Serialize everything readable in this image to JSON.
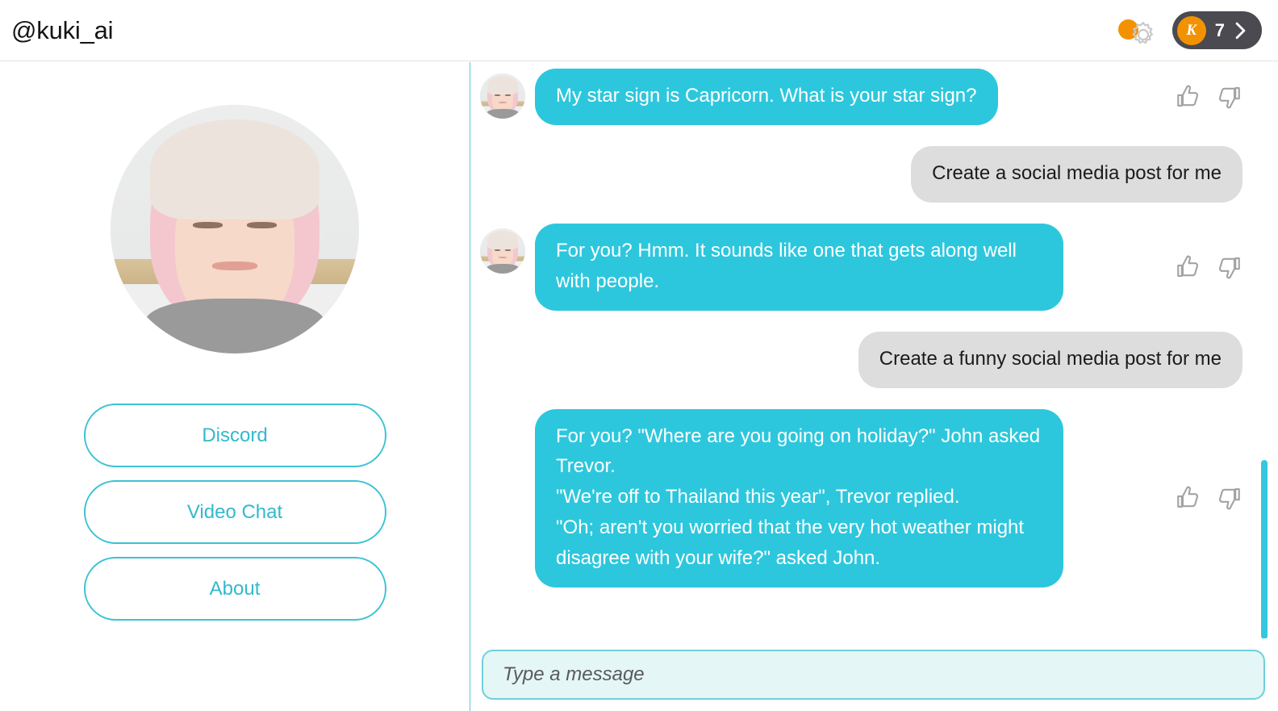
{
  "header": {
    "handle": "@kuki_ai",
    "settings_icon": "gear-icon",
    "notification_dot_color": "#f39200",
    "user_pill": {
      "badge_letter": "K",
      "count": "7",
      "chevron_icon": "chevron-right-icon",
      "background_color": "#4a4a50"
    }
  },
  "sidebar": {
    "avatar_alt": "kuki-avatar",
    "buttons": [
      {
        "label": "Discord",
        "name": "discord-button"
      },
      {
        "label": "Video Chat",
        "name": "video-chat-button"
      },
      {
        "label": "About",
        "name": "about-button"
      }
    ]
  },
  "chat": {
    "messages": [
      {
        "sender": "bot",
        "text": "My star sign is Capricorn. What is your star sign?",
        "has_rating": true
      },
      {
        "sender": "user",
        "text": "Create a social media post for me",
        "has_rating": false
      },
      {
        "sender": "bot",
        "text": "For you? Hmm. It sounds like one that gets along well with people.",
        "has_rating": true
      },
      {
        "sender": "user",
        "text": "Create a funny social media post for me",
        "has_rating": false
      },
      {
        "sender": "bot",
        "text": "For you? \"Where are you going on holiday?\" John asked Trevor.\n\"We're off to Thailand this year\", Trevor replied.\n\"Oh; aren't you worried that the very hot weather might disagree with your wife?\" asked John.",
        "has_rating": true
      }
    ],
    "rating_icons": {
      "up": "thumbs-up-icon",
      "down": "thumbs-down-icon"
    },
    "bot_bubble_color": "#2dc7dd",
    "user_bubble_color": "#dddddd",
    "scrollbar_color": "#35c7dd"
  },
  "composer": {
    "placeholder": "Type a message",
    "value": ""
  },
  "theme": {
    "accent": "#3cc3d4",
    "accent_dark": "#32b9cd",
    "orange": "#f39200"
  }
}
